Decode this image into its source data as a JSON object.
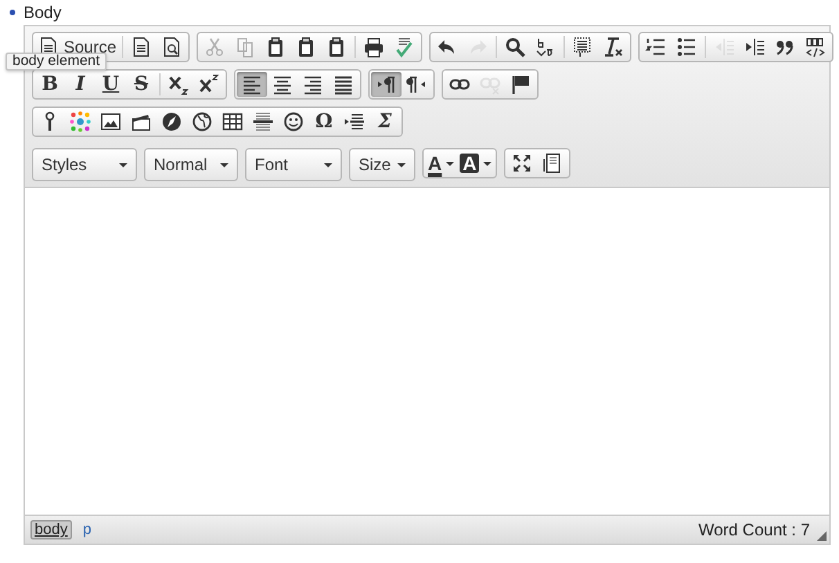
{
  "field_label": "Body",
  "tooltip": "body element",
  "toolbar_rows": [
    [
      [
        {
          "label": "Source",
          "disabled": false
        },
        {
          "kind": "separator"
        },
        {
          "disabled": false
        },
        {
          "disabled": false
        }
      ],
      [
        {
          "disabled": true
        },
        {
          "disabled": true
        },
        {
          "disabled": false
        },
        {
          "disabled": false
        },
        {
          "disabled": false
        },
        {
          "kind": "separator"
        },
        {
          "disabled": false
        },
        {
          "disabled": false
        }
      ],
      [
        {
          "disabled": false
        },
        {
          "disabled": true
        },
        {
          "kind": "separator"
        },
        {
          "disabled": false
        },
        {
          "disabled": false
        },
        {
          "kind": "separator"
        },
        {
          "disabled": false
        },
        {
          "disabled": false
        }
      ],
      [
        {
          "disabled": false
        },
        {
          "disabled": false
        },
        {
          "kind": "separator"
        },
        {
          "disabled": true
        },
        {
          "disabled": false
        },
        {
          "disabled": false
        },
        {
          "disabled": false
        }
      ]
    ],
    [
      [
        {
          "glyph": "B",
          "disabled": false
        },
        {
          "glyph": "I",
          "disabled": false
        },
        {
          "glyph": "U",
          "disabled": false
        },
        {
          "glyph": "S",
          "disabled": false
        },
        {
          "kind": "separator"
        },
        {
          "disabled": false
        },
        {
          "disabled": false
        }
      ],
      [
        {
          "disabled": false,
          "selected": true
        },
        {
          "disabled": false,
          "selected": false
        },
        {
          "disabled": false,
          "selected": false
        },
        {
          "disabled": false,
          "selected": false
        }
      ],
      [
        {
          "disabled": false,
          "selected": true
        },
        {
          "disabled": false,
          "selected": false
        }
      ],
      [
        {
          "disabled": false
        },
        {
          "disabled": true
        },
        {
          "disabled": false
        }
      ]
    ],
    [
      [
        {
          "disabled": false
        },
        {
          "disabled": false
        },
        {
          "disabled": false
        },
        {
          "disabled": false
        },
        {
          "disabled": false
        },
        {
          "disabled": false
        },
        {
          "disabled": false
        },
        {
          "disabled": false
        },
        {
          "disabled": false
        },
        {
          "glyph": "Ω",
          "disabled": false
        },
        {
          "disabled": false
        },
        {
          "glyph": "Σ",
          "disabled": false
        }
      ]
    ],
    [
      [
        {
          "kind": "combo",
          "value": "Styles"
        }
      ],
      [
        {
          "kind": "combo",
          "value": "Normal"
        }
      ],
      [
        {
          "kind": "combo",
          "value": "Font"
        }
      ],
      [
        {
          "kind": "combo",
          "value": "Size"
        }
      ],
      [
        {
          "kind": "color",
          "glyph": "A",
          "disabled": false,
          "filled": false
        },
        {
          "kind": "color",
          "glyph": "A",
          "disabled": false,
          "filled": true
        }
      ],
      [
        {
          "disabled": false
        },
        {
          "disabled": false
        }
      ]
    ]
  ],
  "status_bar": {
    "path": [
      {
        "label": "body",
        "selected": true
      },
      {
        "label": "p",
        "selected": false
      }
    ],
    "word_count": "Word Count : 7"
  }
}
